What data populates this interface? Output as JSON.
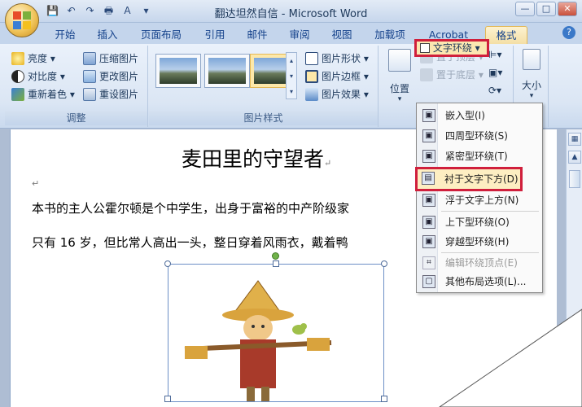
{
  "window": {
    "title": "翻达坦然自信 - Microsoft Word",
    "controls": [
      "—",
      "□",
      "✕"
    ]
  },
  "qat": [
    "💾",
    "↶",
    "↷",
    "🖶",
    "A",
    "▾"
  ],
  "tabs": [
    "开始",
    "插入",
    "页面布局",
    "引用",
    "邮件",
    "审阅",
    "视图",
    "加载项",
    "Acrobat",
    "格式"
  ],
  "active_tab": "格式",
  "help": "?",
  "ribbon": {
    "adjust": {
      "label": "调整",
      "items": [
        "亮度",
        "对比度",
        "重新着色",
        "压缩图片",
        "更改图片",
        "重设图片"
      ]
    },
    "picture_styles": {
      "label": "图片样式",
      "items": [
        "图片形状",
        "图片边框",
        "图片效果"
      ]
    },
    "arrange": {
      "position": "位置",
      "bring_front": "置于顶层",
      "send_back": "置于底层",
      "wrap": "文字环绕",
      "size": "大小"
    }
  },
  "wrap_menu": {
    "items": [
      {
        "label": "嵌入型(I)",
        "icon": "inline-icon"
      },
      {
        "label": "四周型环绕(S)",
        "icon": "square-wrap-icon"
      },
      {
        "label": "紧密型环绕(T)",
        "icon": "tight-wrap-icon"
      },
      {
        "label": "衬于文字下方(D)",
        "icon": "behind-text-icon"
      },
      {
        "label": "浮于文字上方(N)",
        "icon": "in-front-text-icon"
      },
      {
        "label": "上下型环绕(O)",
        "icon": "top-bottom-icon"
      },
      {
        "label": "穿越型环绕(H)",
        "icon": "through-icon"
      },
      {
        "label": "编辑环绕顶点(E)",
        "icon": "edit-points-icon"
      },
      {
        "label": "其他布局选项(L)...",
        "icon": "more-layout-icon"
      }
    ]
  },
  "document": {
    "title": "麦田里的守望者",
    "paragraph_mark": "↵",
    "line1": "本书的主人公霍尔顿是个中学生，出身于富裕的中产阶级家",
    "line2": "只有 16 岁，但比常人高出一头，整日穿着风雨衣，戴着鸭"
  }
}
